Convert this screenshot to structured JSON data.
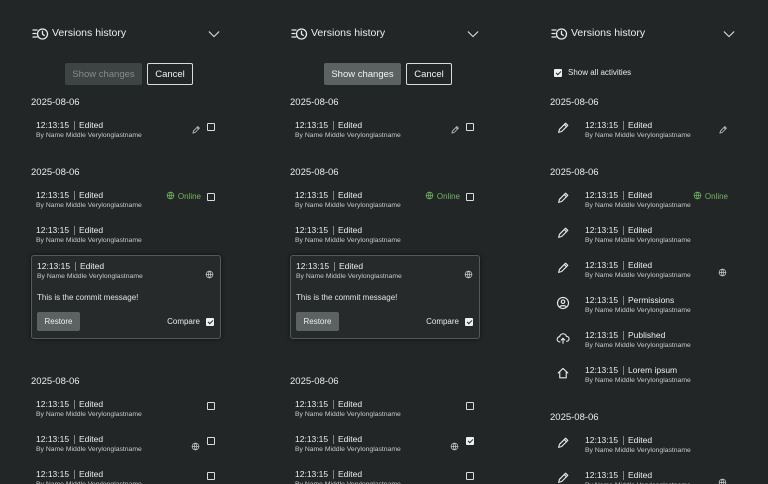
{
  "colors": {
    "background": "#232626",
    "online": "#6fb463",
    "text": "#eceeee",
    "muted": "#c6caca"
  },
  "panels": [
    {
      "title": "Versions history",
      "show_changes_label": "Show changes",
      "show_changes_enabled": false,
      "cancel_label": "Cancel",
      "groups": [
        {
          "date": "2025-08-06",
          "entries": [
            {
              "time": "12:13:15",
              "action": "Edited",
              "author": "By Name Middle Verylonglastname",
              "right": [
                "edit-icon",
                "checkbox"
              ],
              "checked": false
            }
          ]
        },
        {
          "date": "2025-08-06",
          "entries": [
            {
              "time": "12:13:15",
              "action": "Edited",
              "author": "By Name Middle Verylonglastname",
              "online": "Online",
              "right": [
                "online",
                "checkbox"
              ],
              "checked": false
            },
            {
              "time": "12:13:15",
              "action": "Edited",
              "author": "By Name Middle Verylonglastname",
              "right": [],
              "checked": false
            },
            {
              "time": "12:13:15",
              "action": "Edited",
              "author": "By Name Middle Verylonglastname",
              "expanded": true,
              "message": "This is the commit message!",
              "restore_label": "Restore",
              "compare_label": "Compare",
              "compare_checked": true
            }
          ]
        },
        {
          "date": "2025-08-06",
          "entries": [
            {
              "time": "12:13:15",
              "action": "Edited",
              "author": "By Name Middle Verylonglastname",
              "right": [
                "checkbox"
              ],
              "checked": false
            },
            {
              "time": "12:13:15",
              "action": "Edited",
              "author": "By Name Middle Verylonglastname",
              "right": [
                "globe-icon",
                "checkbox"
              ],
              "checked": false
            },
            {
              "time": "12:13:15",
              "action": "Edited",
              "author": "By Name Middle Verylonglastname",
              "right": [
                "checkbox"
              ],
              "checked": false
            }
          ]
        }
      ]
    },
    {
      "title": "Versions history",
      "show_changes_label": "Show changes",
      "show_changes_enabled": true,
      "cancel_label": "Cancel",
      "groups": [
        {
          "date": "2025-08-06",
          "entries": [
            {
              "time": "12:13:15",
              "action": "Edited",
              "author": "By Name Middle Verylonglastname",
              "right": [
                "edit-icon",
                "checkbox"
              ],
              "checked": false
            }
          ]
        },
        {
          "date": "2025-08-06",
          "entries": [
            {
              "time": "12:13:15",
              "action": "Edited",
              "author": "By Name Middle Verylonglastname",
              "online": "Online",
              "right": [
                "online",
                "checkbox"
              ],
              "checked": false
            },
            {
              "time": "12:13:15",
              "action": "Edited",
              "author": "By Name Middle Verylonglastname",
              "right": [],
              "checked": false
            },
            {
              "time": "12:13:15",
              "action": "Edited",
              "author": "By Name Middle Verylonglastname",
              "expanded": true,
              "message": "This is the commit message!",
              "restore_label": "Restore",
              "compare_label": "Compare",
              "compare_checked": true
            }
          ]
        },
        {
          "date": "2025-08-06",
          "entries": [
            {
              "time": "12:13:15",
              "action": "Edited",
              "author": "By Name Middle Verylonglastname",
              "right": [
                "checkbox"
              ],
              "checked": false
            },
            {
              "time": "12:13:15",
              "action": "Edited",
              "author": "By Name Middle Verylonglastname",
              "right": [
                "globe-icon",
                "checkbox"
              ],
              "checked": true
            },
            {
              "time": "12:13:15",
              "action": "Edited",
              "author": "By Name Middle Verylonglastname",
              "right": [
                "checkbox"
              ],
              "checked": false
            }
          ]
        }
      ]
    },
    {
      "title": "Versions history",
      "show_all_label": "Show all activities",
      "show_all_checked": true,
      "groups": [
        {
          "date": "2025-08-06",
          "entries": [
            {
              "time": "12:13:15",
              "action": "Edited",
              "author": "By Name Middle Verylonglastname",
              "icon": "pencil-icon",
              "right": [
                "edit-icon"
              ]
            }
          ]
        },
        {
          "date": "2025-08-06",
          "entries": [
            {
              "time": "12:13:15",
              "action": "Edited",
              "author": "By Name Middle Verylonglastname",
              "icon": "pencil-icon",
              "online": "Online",
              "right": [
                "online"
              ]
            },
            {
              "time": "12:13:15",
              "action": "Edited",
              "author": "By Name Middle Verylonglastname",
              "icon": "pencil-icon",
              "right": []
            },
            {
              "time": "12:13:15",
              "action": "Edited",
              "author": "By Name Middle Verylonglastname",
              "icon": "pencil-icon",
              "right": [
                "globe-icon"
              ]
            },
            {
              "time": "12:13:15",
              "action": "Permissions",
              "author": "By Name Middle Verylonglastname",
              "icon": "user-circle-icon",
              "right": []
            },
            {
              "time": "12:13:15",
              "action": "Published",
              "author": "By Name Middle Verylonglastname",
              "icon": "cloud-upload-icon",
              "right": []
            },
            {
              "time": "12:13:15",
              "action": "Lorem ipsum",
              "author": "By Name Middle Verylonglastname",
              "icon": "home-icon",
              "right": []
            }
          ]
        },
        {
          "date": "2025-08-06",
          "entries": [
            {
              "time": "12:13:15",
              "action": "Edited",
              "author": "By Name Middle Verylonglastname",
              "icon": "pencil-icon",
              "right": []
            },
            {
              "time": "12:13:15",
              "action": "Edited",
              "author": "By Name Middle Verylonglastname",
              "icon": "pencil-icon",
              "right": [
                "globe-icon"
              ]
            }
          ]
        }
      ]
    }
  ]
}
